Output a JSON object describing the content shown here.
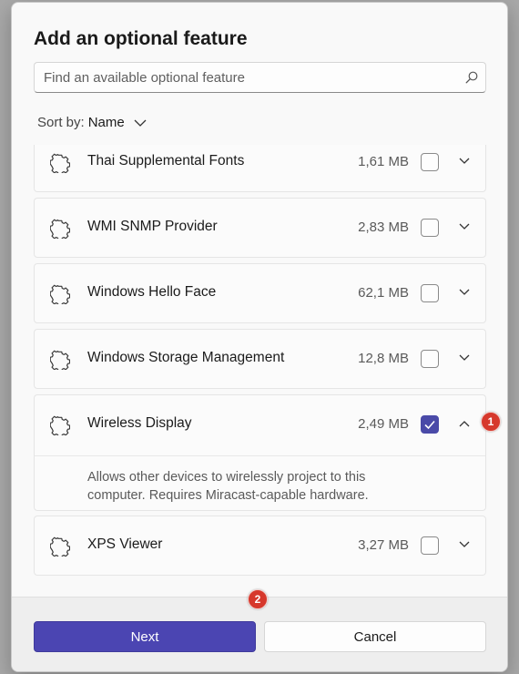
{
  "dialog": {
    "title": "Add an optional feature",
    "search_placeholder": "Find an available optional feature",
    "sort_label": "Sort by:",
    "sort_value": "Name"
  },
  "features": [
    {
      "name": "Thai Supplemental Fonts",
      "size": "1,61 MB",
      "checked": false,
      "expanded": false
    },
    {
      "name": "WMI SNMP Provider",
      "size": "2,83 MB",
      "checked": false,
      "expanded": false
    },
    {
      "name": "Windows Hello Face",
      "size": "62,1 MB",
      "checked": false,
      "expanded": false
    },
    {
      "name": "Windows Storage Management",
      "size": "12,8 MB",
      "checked": false,
      "expanded": false
    },
    {
      "name": "Wireless Display",
      "size": "2,49 MB",
      "checked": true,
      "expanded": true,
      "description": "Allows other devices to wirelessly project to this computer.  Requires Miracast-capable hardware."
    },
    {
      "name": "XPS Viewer",
      "size": "3,27 MB",
      "checked": false,
      "expanded": false
    }
  ],
  "footer": {
    "next_label": "Next",
    "cancel_label": "Cancel"
  },
  "annotations": {
    "badge_1": "1",
    "badge_2": "2"
  },
  "colors": {
    "accent": "#4b45b2",
    "badge": "#d6382c"
  }
}
